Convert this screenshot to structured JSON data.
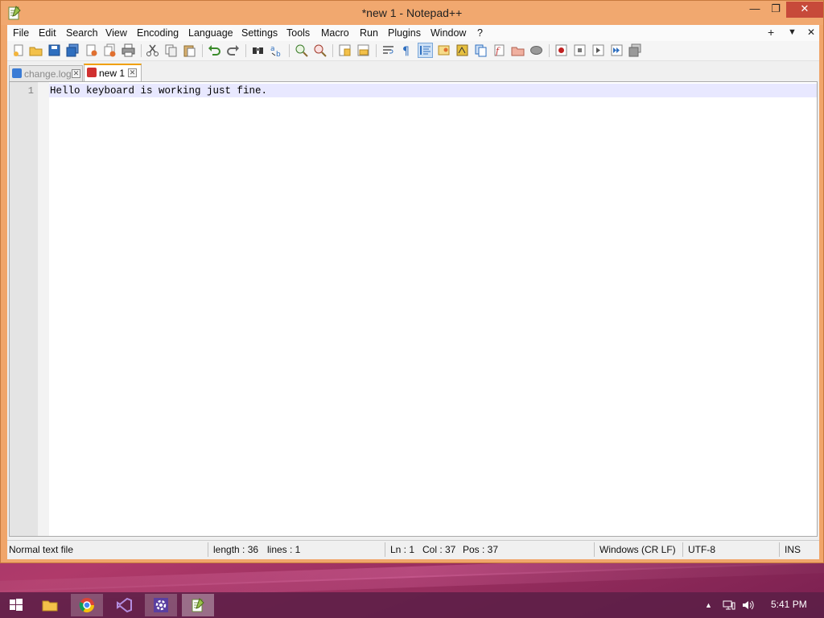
{
  "window": {
    "title": "*new 1 - Notepad++",
    "minimize_glyph": "—",
    "maximize_glyph": "❐",
    "close_glyph": "✕"
  },
  "menu": {
    "items": [
      "File",
      "Edit",
      "Search",
      "View",
      "Encoding",
      "Language",
      "Settings",
      "Tools",
      "Macro",
      "Run",
      "Plugins",
      "Window",
      "?"
    ],
    "right": {
      "add": "+",
      "dropdown": "▼",
      "close": "✕"
    }
  },
  "toolbar": {
    "icons": [
      "new-file-icon",
      "open-file-icon",
      "save-icon",
      "save-all-icon",
      "close-icon",
      "close-all-icon",
      "print-icon",
      "cut-icon",
      "copy-icon",
      "paste-icon",
      "undo-icon",
      "redo-icon",
      "find-icon",
      "replace-icon",
      "zoom-in-icon",
      "zoom-out-icon",
      "sync-vertical-icon",
      "sync-horizontal-icon",
      "word-wrap-icon",
      "show-all-chars-icon",
      "indent-guide-icon",
      "udl-icon",
      "doc-map-icon",
      "doc-list-icon",
      "function-list-icon",
      "folder-workspace-icon",
      "monitoring-icon",
      "record-macro-icon",
      "stop-recording-icon",
      "play-macro-icon",
      "run-macro-multiple-icon",
      "save-macro-icon"
    ]
  },
  "tabs": [
    {
      "label": "change.log",
      "active": false,
      "color": "#3a7bd5"
    },
    {
      "label": "new 1",
      "active": true,
      "color": "#d03030"
    }
  ],
  "editor": {
    "line_number": "1",
    "text": "Hello keyboard is working just fine."
  },
  "status": {
    "file_type": "Normal text file",
    "length": "length : 36",
    "lines": "lines : 1",
    "ln": "Ln : 1",
    "col": "Col : 37",
    "pos": "Pos : 37",
    "eol": "Windows (CR LF)",
    "encoding": "UTF-8",
    "mode": "INS"
  },
  "taskbar": {
    "apps": [
      "start-icon",
      "file-explorer-icon",
      "chrome-icon",
      "visual-studio-icon",
      "settings-icon",
      "notepadpp-icon"
    ],
    "tray": {
      "up": "▲",
      "clock": "5:41 PM"
    }
  },
  "colors": {
    "frame": "#f1a86f",
    "accent": "#f0a000",
    "close_button": "#c74a3a"
  }
}
